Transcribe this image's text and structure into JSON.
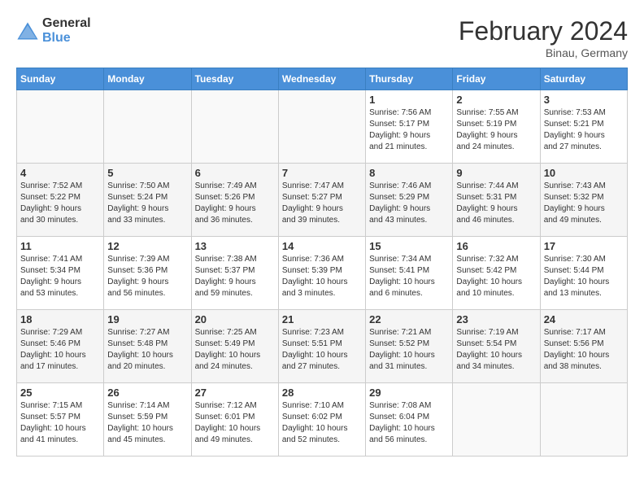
{
  "header": {
    "logo_general": "General",
    "logo_blue": "Blue",
    "month_year": "February 2024",
    "location": "Binau, Germany"
  },
  "days_of_week": [
    "Sunday",
    "Monday",
    "Tuesday",
    "Wednesday",
    "Thursday",
    "Friday",
    "Saturday"
  ],
  "weeks": [
    [
      {
        "day": "",
        "info": ""
      },
      {
        "day": "",
        "info": ""
      },
      {
        "day": "",
        "info": ""
      },
      {
        "day": "",
        "info": ""
      },
      {
        "day": "1",
        "info": "Sunrise: 7:56 AM\nSunset: 5:17 PM\nDaylight: 9 hours\nand 21 minutes."
      },
      {
        "day": "2",
        "info": "Sunrise: 7:55 AM\nSunset: 5:19 PM\nDaylight: 9 hours\nand 24 minutes."
      },
      {
        "day": "3",
        "info": "Sunrise: 7:53 AM\nSunset: 5:21 PM\nDaylight: 9 hours\nand 27 minutes."
      }
    ],
    [
      {
        "day": "4",
        "info": "Sunrise: 7:52 AM\nSunset: 5:22 PM\nDaylight: 9 hours\nand 30 minutes."
      },
      {
        "day": "5",
        "info": "Sunrise: 7:50 AM\nSunset: 5:24 PM\nDaylight: 9 hours\nand 33 minutes."
      },
      {
        "day": "6",
        "info": "Sunrise: 7:49 AM\nSunset: 5:26 PM\nDaylight: 9 hours\nand 36 minutes."
      },
      {
        "day": "7",
        "info": "Sunrise: 7:47 AM\nSunset: 5:27 PM\nDaylight: 9 hours\nand 39 minutes."
      },
      {
        "day": "8",
        "info": "Sunrise: 7:46 AM\nSunset: 5:29 PM\nDaylight: 9 hours\nand 43 minutes."
      },
      {
        "day": "9",
        "info": "Sunrise: 7:44 AM\nSunset: 5:31 PM\nDaylight: 9 hours\nand 46 minutes."
      },
      {
        "day": "10",
        "info": "Sunrise: 7:43 AM\nSunset: 5:32 PM\nDaylight: 9 hours\nand 49 minutes."
      }
    ],
    [
      {
        "day": "11",
        "info": "Sunrise: 7:41 AM\nSunset: 5:34 PM\nDaylight: 9 hours\nand 53 minutes."
      },
      {
        "day": "12",
        "info": "Sunrise: 7:39 AM\nSunset: 5:36 PM\nDaylight: 9 hours\nand 56 minutes."
      },
      {
        "day": "13",
        "info": "Sunrise: 7:38 AM\nSunset: 5:37 PM\nDaylight: 9 hours\nand 59 minutes."
      },
      {
        "day": "14",
        "info": "Sunrise: 7:36 AM\nSunset: 5:39 PM\nDaylight: 10 hours\nand 3 minutes."
      },
      {
        "day": "15",
        "info": "Sunrise: 7:34 AM\nSunset: 5:41 PM\nDaylight: 10 hours\nand 6 minutes."
      },
      {
        "day": "16",
        "info": "Sunrise: 7:32 AM\nSunset: 5:42 PM\nDaylight: 10 hours\nand 10 minutes."
      },
      {
        "day": "17",
        "info": "Sunrise: 7:30 AM\nSunset: 5:44 PM\nDaylight: 10 hours\nand 13 minutes."
      }
    ],
    [
      {
        "day": "18",
        "info": "Sunrise: 7:29 AM\nSunset: 5:46 PM\nDaylight: 10 hours\nand 17 minutes."
      },
      {
        "day": "19",
        "info": "Sunrise: 7:27 AM\nSunset: 5:48 PM\nDaylight: 10 hours\nand 20 minutes."
      },
      {
        "day": "20",
        "info": "Sunrise: 7:25 AM\nSunset: 5:49 PM\nDaylight: 10 hours\nand 24 minutes."
      },
      {
        "day": "21",
        "info": "Sunrise: 7:23 AM\nSunset: 5:51 PM\nDaylight: 10 hours\nand 27 minutes."
      },
      {
        "day": "22",
        "info": "Sunrise: 7:21 AM\nSunset: 5:52 PM\nDaylight: 10 hours\nand 31 minutes."
      },
      {
        "day": "23",
        "info": "Sunrise: 7:19 AM\nSunset: 5:54 PM\nDaylight: 10 hours\nand 34 minutes."
      },
      {
        "day": "24",
        "info": "Sunrise: 7:17 AM\nSunset: 5:56 PM\nDaylight: 10 hours\nand 38 minutes."
      }
    ],
    [
      {
        "day": "25",
        "info": "Sunrise: 7:15 AM\nSunset: 5:57 PM\nDaylight: 10 hours\nand 41 minutes."
      },
      {
        "day": "26",
        "info": "Sunrise: 7:14 AM\nSunset: 5:59 PM\nDaylight: 10 hours\nand 45 minutes."
      },
      {
        "day": "27",
        "info": "Sunrise: 7:12 AM\nSunset: 6:01 PM\nDaylight: 10 hours\nand 49 minutes."
      },
      {
        "day": "28",
        "info": "Sunrise: 7:10 AM\nSunset: 6:02 PM\nDaylight: 10 hours\nand 52 minutes."
      },
      {
        "day": "29",
        "info": "Sunrise: 7:08 AM\nSunset: 6:04 PM\nDaylight: 10 hours\nand 56 minutes."
      },
      {
        "day": "",
        "info": ""
      },
      {
        "day": "",
        "info": ""
      }
    ]
  ]
}
